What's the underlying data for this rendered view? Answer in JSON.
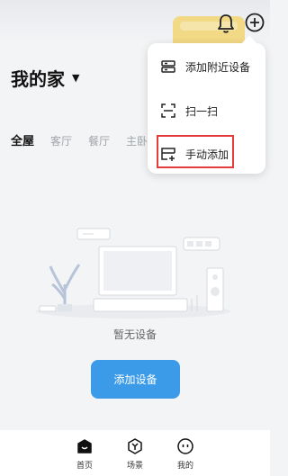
{
  "header": {
    "home_name": "我的家",
    "notification_icon": "bell-icon",
    "add_icon": "plus-circle-icon"
  },
  "room_tabs": [
    "全屋",
    "客厅",
    "餐厅",
    "主卧"
  ],
  "empty_state": {
    "message": "暂无设备",
    "add_button": "添加设备"
  },
  "popup_menu": [
    {
      "label": "添加附近设备",
      "icon": "nearby-devices-icon"
    },
    {
      "label": "扫一扫",
      "icon": "scan-icon"
    },
    {
      "label": "手动添加",
      "icon": "manual-add-icon"
    }
  ],
  "bottom_nav": [
    {
      "label": "首页",
      "icon": "home-icon"
    },
    {
      "label": "场景",
      "icon": "scene-icon"
    },
    {
      "label": "我的",
      "icon": "profile-icon"
    }
  ],
  "colors": {
    "accent": "#3b9be8",
    "highlight": "#e43b3b"
  }
}
